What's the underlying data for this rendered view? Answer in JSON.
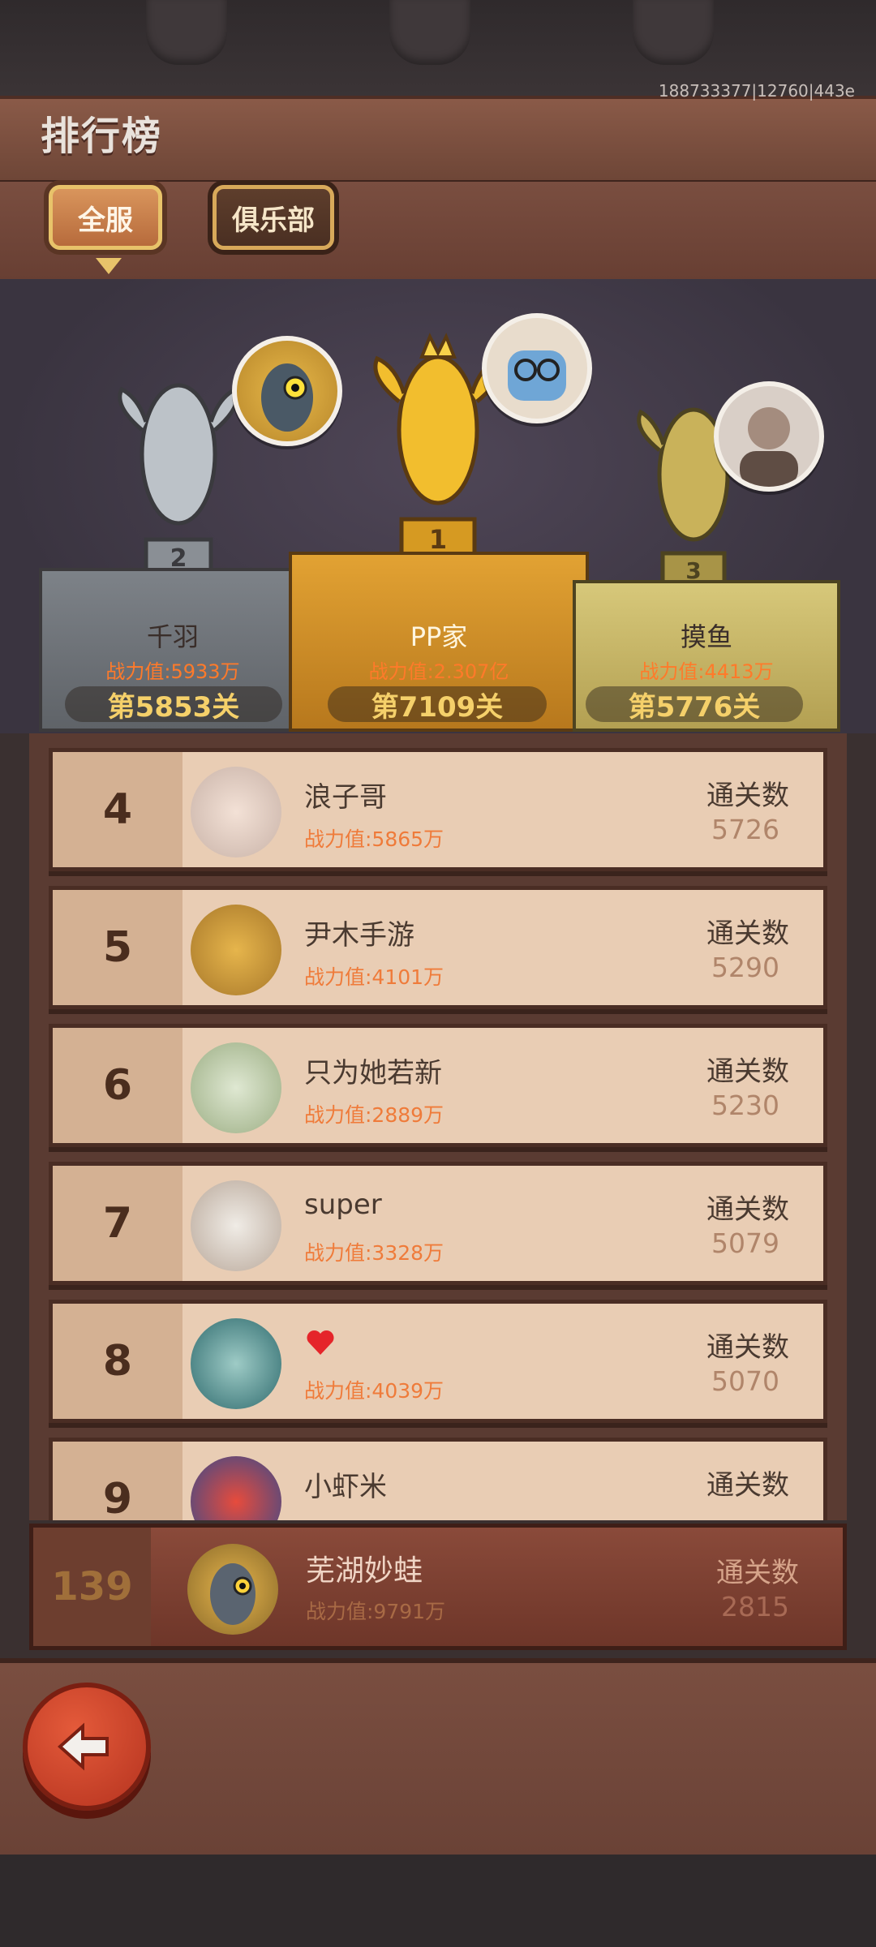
{
  "header": {
    "title": "排行榜",
    "device_id": "188733377|12760|443e"
  },
  "tabs": [
    {
      "label": "全服",
      "active": true
    },
    {
      "label": "俱乐部",
      "active": false
    }
  ],
  "podium": [
    {
      "rank": 2,
      "name": "千羽",
      "power": "战力值:5933万",
      "stage": "第5853关"
    },
    {
      "rank": 1,
      "name": "PP家",
      "power": "战力值:2.307亿",
      "stage": "第7109关"
    },
    {
      "rank": 3,
      "name": "摸鱼",
      "power": "战力值:4413万",
      "stage": "第5776关"
    }
  ],
  "list": [
    {
      "rank": "4",
      "name": "浪子哥",
      "power": "战力值:5865万",
      "label": "通关数",
      "count": "5726"
    },
    {
      "rank": "5",
      "name": "尹木手游",
      "power": "战力值:4101万",
      "label": "通关数",
      "count": "5290"
    },
    {
      "rank": "6",
      "name": "只为她若新",
      "power": "战力值:2889万",
      "label": "通关数",
      "count": "5230"
    },
    {
      "rank": "7",
      "name": "super",
      "power": "战力值:3328万",
      "label": "通关数",
      "count": "5079"
    },
    {
      "rank": "8",
      "name": "",
      "power": "战力值:4039万",
      "label": "通关数",
      "count": "5070"
    },
    {
      "rank": "9",
      "name": "小虾米",
      "power": "",
      "label": "通关数",
      "count": ""
    }
  ],
  "me": {
    "rank": "139",
    "name": "芜湖妙蛙",
    "power": "战力值:9791万",
    "label": "通关数",
    "count": "2815"
  },
  "colors": {
    "accent": "#ef7b3a",
    "gold": "#f5d06a",
    "wood": "#6e4637"
  },
  "icons": {
    "back": "back-arrow-icon",
    "heart": "heart-icon"
  }
}
